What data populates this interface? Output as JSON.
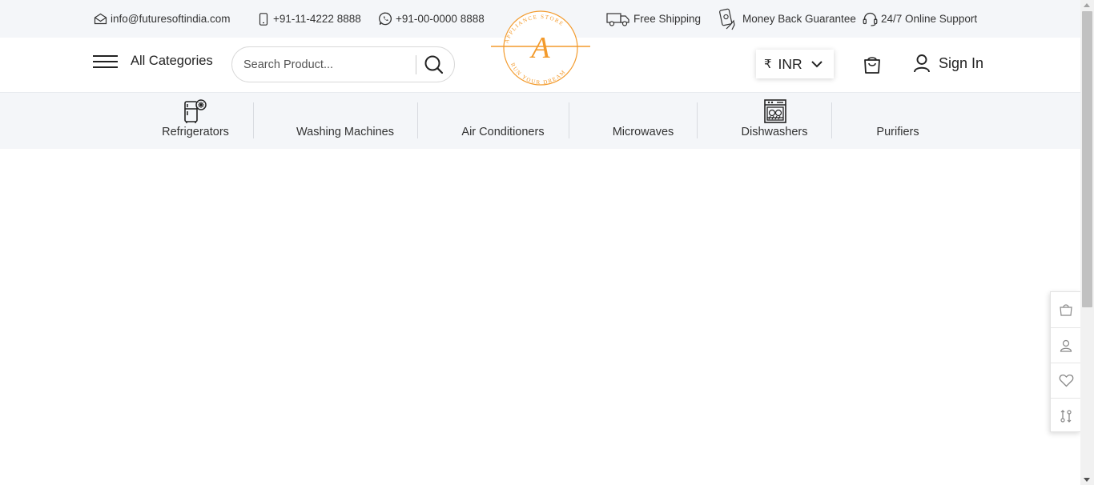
{
  "topbar": {
    "email": "info@futuresoftindia.com",
    "phone": "+91-11-4222 8888",
    "whatsapp": "+91-00-0000 8888",
    "shipping": "Free Shipping",
    "guarantee": "Money Back Guarantee",
    "support": "24/7 Online Support"
  },
  "header": {
    "all_categories": "All Categories",
    "search_placeholder": "Search Product...",
    "currency_symbol": "₹",
    "currency_code": "INR",
    "sign_in": "Sign In"
  },
  "logo": {
    "letter": "A",
    "ring_top": "APPLIANCE STORE",
    "ring_bottom": "RUN YOUR DREAM",
    "color": "#f39a2b"
  },
  "categories": [
    {
      "label": "Refrigerators",
      "icon": "refrigerator-icon"
    },
    {
      "label": "Washing Machines",
      "icon": ""
    },
    {
      "label": "Air Conditioners",
      "icon": ""
    },
    {
      "label": "Microwaves",
      "icon": ""
    },
    {
      "label": "Dishwashers",
      "icon": "dishwasher-icon"
    },
    {
      "label": "Purifiers",
      "icon": ""
    }
  ],
  "side_tools": [
    "cart-icon",
    "user-icon",
    "heart-icon",
    "compare-icon"
  ],
  "colors": {
    "bar_background": "#f4f6f9",
    "accent": "#f39a2b",
    "text": "#222222"
  }
}
